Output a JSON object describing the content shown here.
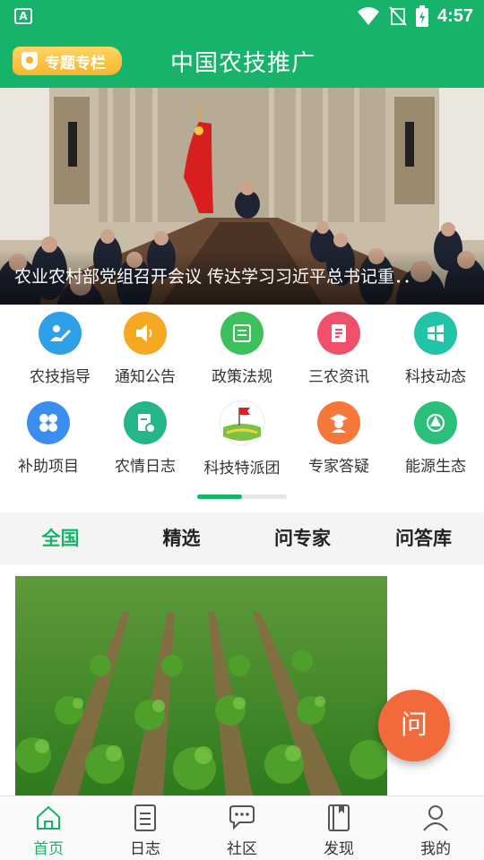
{
  "status_bar": {
    "time": "4:57",
    "app_badge": "A"
  },
  "header": {
    "topic_button": "专题专栏",
    "title": "中国农技推广"
  },
  "banner": {
    "caption": "农业农村部党组召开会议 传达学习习近平总书记重．．"
  },
  "grid": [
    {
      "label": "农技指导",
      "icon": "guidance-icon",
      "color": "#2ea0e8"
    },
    {
      "label": "通知公告",
      "icon": "speaker-icon",
      "color": "#f7a823"
    },
    {
      "label": "政策法规",
      "icon": "policy-icon",
      "color": "#3cc05c"
    },
    {
      "label": "三农资讯",
      "icon": "news-icon",
      "color": "#f0506a"
    },
    {
      "label": "科技动态",
      "icon": "tech-icon",
      "color": "#22c4a8"
    },
    {
      "label": "补助项目",
      "icon": "subsidy-icon",
      "color": "#3b8df0"
    },
    {
      "label": "农情日志",
      "icon": "log-icon",
      "color": "#26b58a"
    },
    {
      "label": "科技特派团",
      "icon": "flag-field-icon",
      "color": "#e8e8e8"
    },
    {
      "label": "专家答疑",
      "icon": "expert-icon",
      "color": "#f5773a"
    },
    {
      "label": "能源生态",
      "icon": "energy-icon",
      "color": "#2bbf7a"
    }
  ],
  "tabs": [
    {
      "label": "全国",
      "active": true
    },
    {
      "label": "精选",
      "active": false
    },
    {
      "label": "问专家",
      "active": false
    },
    {
      "label": "问答库",
      "active": false
    }
  ],
  "fab": {
    "label": "问"
  },
  "bottom_nav": [
    {
      "label": "首页",
      "icon": "home-icon",
      "active": true
    },
    {
      "label": "日志",
      "icon": "journal-icon",
      "active": false
    },
    {
      "label": "社区",
      "icon": "chat-icon",
      "active": false
    },
    {
      "label": "发现",
      "icon": "book-icon",
      "active": false
    },
    {
      "label": "我的",
      "icon": "user-icon",
      "active": false
    }
  ],
  "colors": {
    "primary": "#17b36b",
    "fab": "#f26a3b",
    "topic": "#f6b62b"
  }
}
